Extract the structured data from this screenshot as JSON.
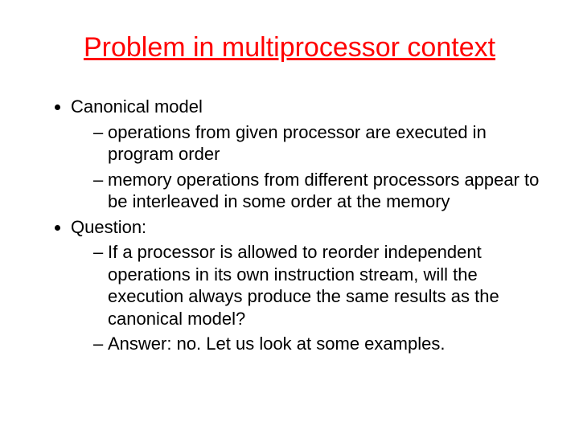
{
  "title": "Problem in multiprocessor context",
  "bullets": {
    "b1": "Canonical model",
    "b1s1": "operations from given processor are executed in program order",
    "b1s2": "memory operations from different processors appear to be interleaved in some order at the memory",
    "b2": "Question:",
    "b2s1": "If a processor is allowed to reorder independent operations in its own instruction stream, will the execution always produce the same results as the canonical model?",
    "b2s2": "Answer: no. Let us look at some examples."
  }
}
